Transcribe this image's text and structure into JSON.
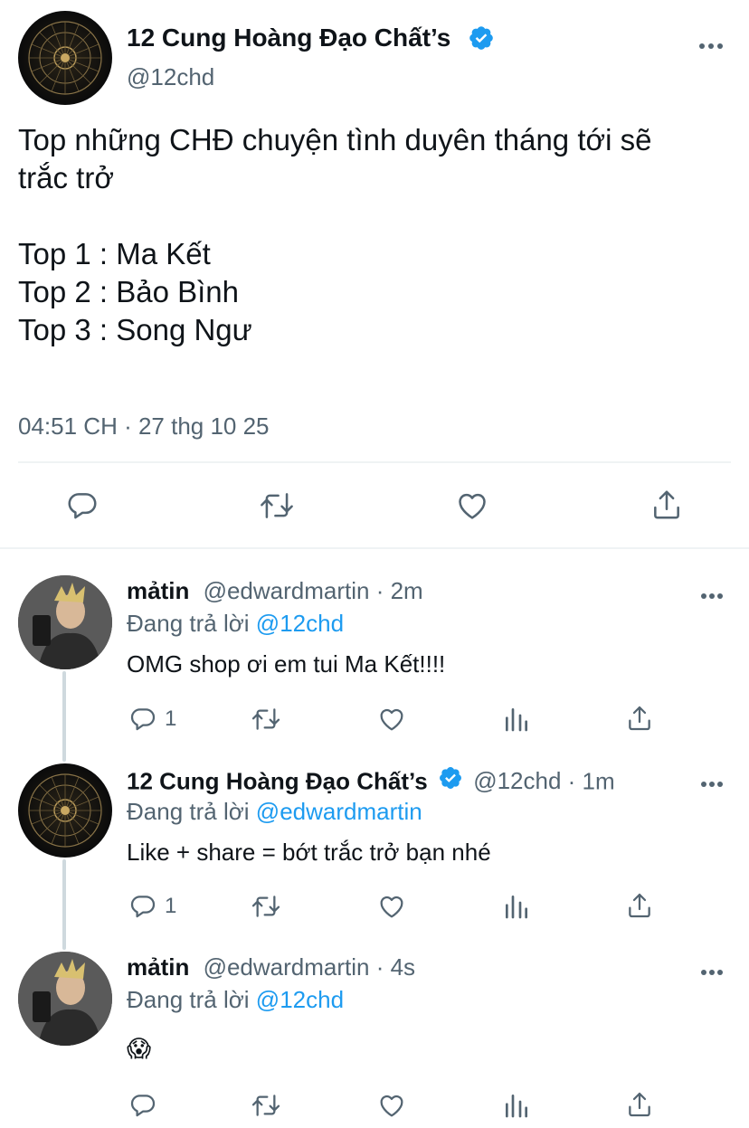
{
  "main_tweet": {
    "display_name": "12 Cung Hoàng Đạo Chất’s",
    "handle": "@12chd",
    "lines": [
      "Top những CHĐ chuyện tình duyên tháng tới sẽ",
      "trắc trở",
      "",
      "Top 1 : Ma Kết",
      "Top 2 : Bảo Bình",
      "Top 3 : Song Ngư"
    ],
    "timestamp": "04:51 CH · 27 thg 10 25"
  },
  "replies": [
    {
      "display_name": "mảtin",
      "handle": "@edwardmartin",
      "time": "· 2m",
      "replying_prefix": "Đang trả lời",
      "replying_to": "@12chd",
      "text": "OMG shop ơi em tui Ma Kết!!!!",
      "reply_count": "1"
    },
    {
      "display_name": "12 Cung Hoàng Đạo Chất’s",
      "handle": "@12chd",
      "time": "· 1m",
      "replying_prefix": "Đang trả lời",
      "replying_to": "@edwardmartin",
      "text": "Like + share = bớt trắc trở bạn nhé",
      "reply_count": "1"
    },
    {
      "display_name": "mảtin",
      "handle": "@edwardmartin",
      "time": "· 4s",
      "replying_prefix": "Đang trả lời",
      "replying_to": "@12chd",
      "text": "😱",
      "reply_count": ""
    }
  ],
  "icons": {
    "more": "more-horizontal-icon",
    "reply": "reply-icon",
    "retweet": "retweet-icon",
    "like": "like-icon",
    "views": "views-icon",
    "share": "share-icon",
    "verified": "verified-badge-icon"
  },
  "colors": {
    "accent": "#1d9bf0",
    "text": "#0f1419",
    "muted": "#536471",
    "divider": "#eff3f4"
  }
}
